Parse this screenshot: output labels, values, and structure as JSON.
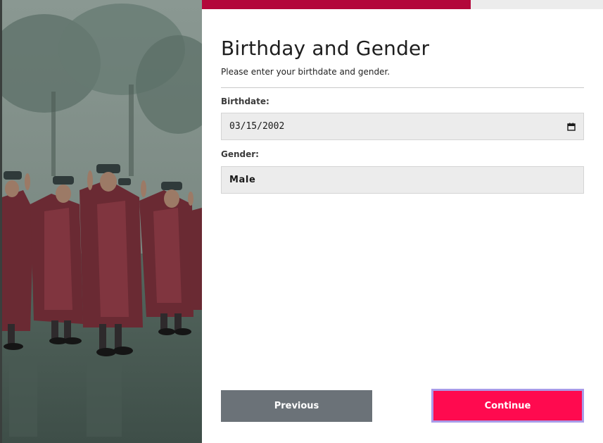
{
  "progress": {
    "fraction": 0.67,
    "fill_color": "#b3073b",
    "track_color": "#ececec"
  },
  "header": {
    "title": "Birthday and Gender",
    "subtitle": "Please enter your birthdate and gender."
  },
  "form": {
    "birthdate": {
      "label": "Birthdate:",
      "value": "03/15/2002",
      "icon": "calendar-icon"
    },
    "gender": {
      "label": "Gender:",
      "value": "Male"
    }
  },
  "actions": {
    "previous_label": "Previous",
    "continue_label": "Continue",
    "previous_color": "#6b7278",
    "continue_color": "#ff0a4f"
  }
}
